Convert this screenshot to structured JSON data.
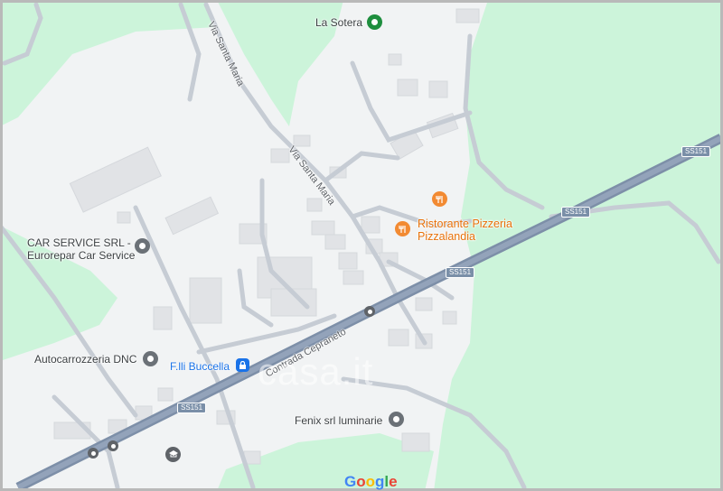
{
  "colors": {
    "land": "#f1f3f4",
    "green": "#ccf4da",
    "road": "#c9ced6",
    "highway": "#8ea0b8",
    "building": "#e3e5e8"
  },
  "places": {
    "la_sotera": "La Sotera",
    "car_service_line1": "CAR SERVICE SRL -",
    "car_service_line2": "Eurorepar Car Service",
    "ristorante_line1": "Ristorante Pizzeria",
    "ristorante_line2": "Pizzalandia",
    "autocarrozzeria": "Autocarrozzeria DNC",
    "buccella": "F.lli Buccella",
    "fenix": "Fenix srl luminarie"
  },
  "roads": {
    "via_santa_maria_1": "Via Santa Maria",
    "via_santa_maria_2": "Via Santa Maria",
    "contrada": "Contrada Cepraneto",
    "ss151_a": "SS151",
    "ss151_b": "SS151",
    "ss151_c": "SS151",
    "ss151_d": "SS151"
  },
  "icons": {
    "la_sotera": "park-pin-icon",
    "car_service": "business-pin-icon",
    "ristorante": "restaurant-pin-icon",
    "autocarrozzeria": "business-pin-icon",
    "buccella": "shopping-lock-icon",
    "fenix": "business-pin-icon",
    "bus_stop": "bus-icon",
    "school": "school-icon"
  },
  "watermark": "casa.it",
  "google_logo": [
    "G",
    "o",
    "o",
    "g",
    "l",
    "e"
  ]
}
